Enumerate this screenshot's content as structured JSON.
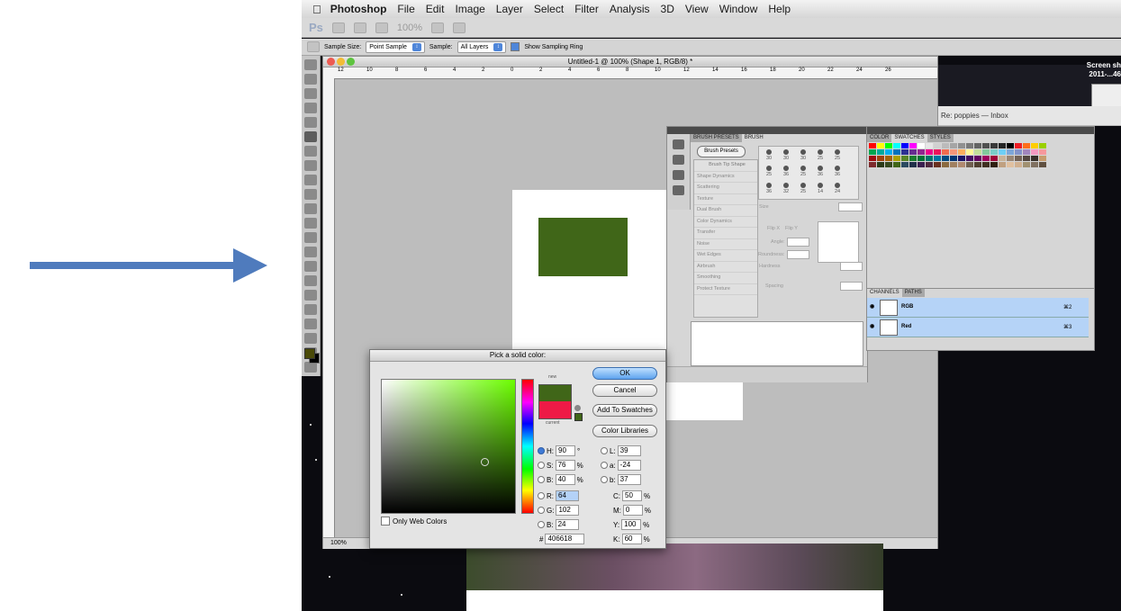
{
  "menubar": {
    "apple_icon": "apple-icon",
    "app_name": "Photoshop",
    "items": [
      "File",
      "Edit",
      "Image",
      "Layer",
      "Select",
      "Filter",
      "Analysis",
      "3D",
      "View",
      "Window",
      "Help"
    ]
  },
  "appbar": {
    "logo": "Ps",
    "zoom": "100%"
  },
  "options": {
    "sample_size_label": "Sample Size:",
    "sample_size_value": "Point Sample",
    "sample_label": "Sample:",
    "sample_value": "All Layers",
    "show_ring_label": "Show Sampling Ring"
  },
  "document": {
    "title": "Untitled-1 @ 100% (Shape 1, RGB/8) *",
    "ruler_ticks": [
      "12",
      "10",
      "8",
      "6",
      "4",
      "2",
      "0",
      "2",
      "4",
      "6",
      "8",
      "10",
      "12",
      "14",
      "16",
      "18",
      "20",
      "22",
      "24",
      "26"
    ],
    "zoom": "100%",
    "shape_color": "#406618"
  },
  "background_window": {
    "mail_subject": "Re: poppies — Inbox",
    "screenshot_label_1": "Screen sh",
    "screenshot_label_2": "2011-...46"
  },
  "brush_panel": {
    "tabs": [
      "BRUSH PRESETS",
      "BRUSH"
    ],
    "presets_button": "Brush Presets",
    "sections": [
      "Brush Tip Shape",
      "Shape Dynamics",
      "Scattering",
      "Texture",
      "Dual Brush",
      "Color Dynamics",
      "Transfer",
      "Noise",
      "Wet Edges",
      "Airbrush",
      "Smoothing",
      "Protect Texture"
    ],
    "tip_sizes": [
      "30",
      "30",
      "30",
      "25",
      "25",
      "25",
      "36",
      "25",
      "36",
      "36",
      "36",
      "32",
      "25",
      "14",
      "24"
    ],
    "size_label": "Size",
    "flip_x": "Flip X",
    "flip_y": "Flip Y",
    "angle_label": "Angle:",
    "roundness_label": "Roundness:",
    "hardness_label": "Hardness",
    "spacing_label": "Spacing"
  },
  "swatches_panel": {
    "tabs": [
      "COLOR",
      "SWATCHES",
      "STYLES"
    ]
  },
  "channels_panel": {
    "tabs": [
      "CHANNELS",
      "PATHS"
    ],
    "rows": [
      {
        "name": "RGB",
        "shortcut": "⌘2"
      },
      {
        "name": "Red",
        "shortcut": "⌘3"
      }
    ]
  },
  "picker": {
    "title": "Pick a solid color:",
    "ok": "OK",
    "cancel": "Cancel",
    "add_to_swatches": "Add To Swatches",
    "color_libraries": "Color Libraries",
    "new_label": "new",
    "current_label": "current",
    "new_color": "#406618",
    "current_color": "#ee1a46",
    "only_web_colors": "Only Web Colors",
    "hsb": [
      {
        "label": "H:",
        "value": "90",
        "unit": "°"
      },
      {
        "label": "S:",
        "value": "76",
        "unit": "%"
      },
      {
        "label": "B:",
        "value": "40",
        "unit": "%"
      }
    ],
    "rgb": [
      {
        "label": "R:",
        "value": "64"
      },
      {
        "label": "G:",
        "value": "102"
      },
      {
        "label": "B:",
        "value": "24"
      }
    ],
    "lab": [
      {
        "label": "L:",
        "value": "39"
      },
      {
        "label": "a:",
        "value": "-24"
      },
      {
        "label": "b:",
        "value": "37"
      }
    ],
    "cmyk": [
      {
        "label": "C:",
        "value": "50",
        "unit": "%"
      },
      {
        "label": "M:",
        "value": "0",
        "unit": "%"
      },
      {
        "label": "Y:",
        "value": "100",
        "unit": "%"
      },
      {
        "label": "K:",
        "value": "60",
        "unit": "%"
      }
    ],
    "hex_label": "#",
    "hex": "406618"
  }
}
